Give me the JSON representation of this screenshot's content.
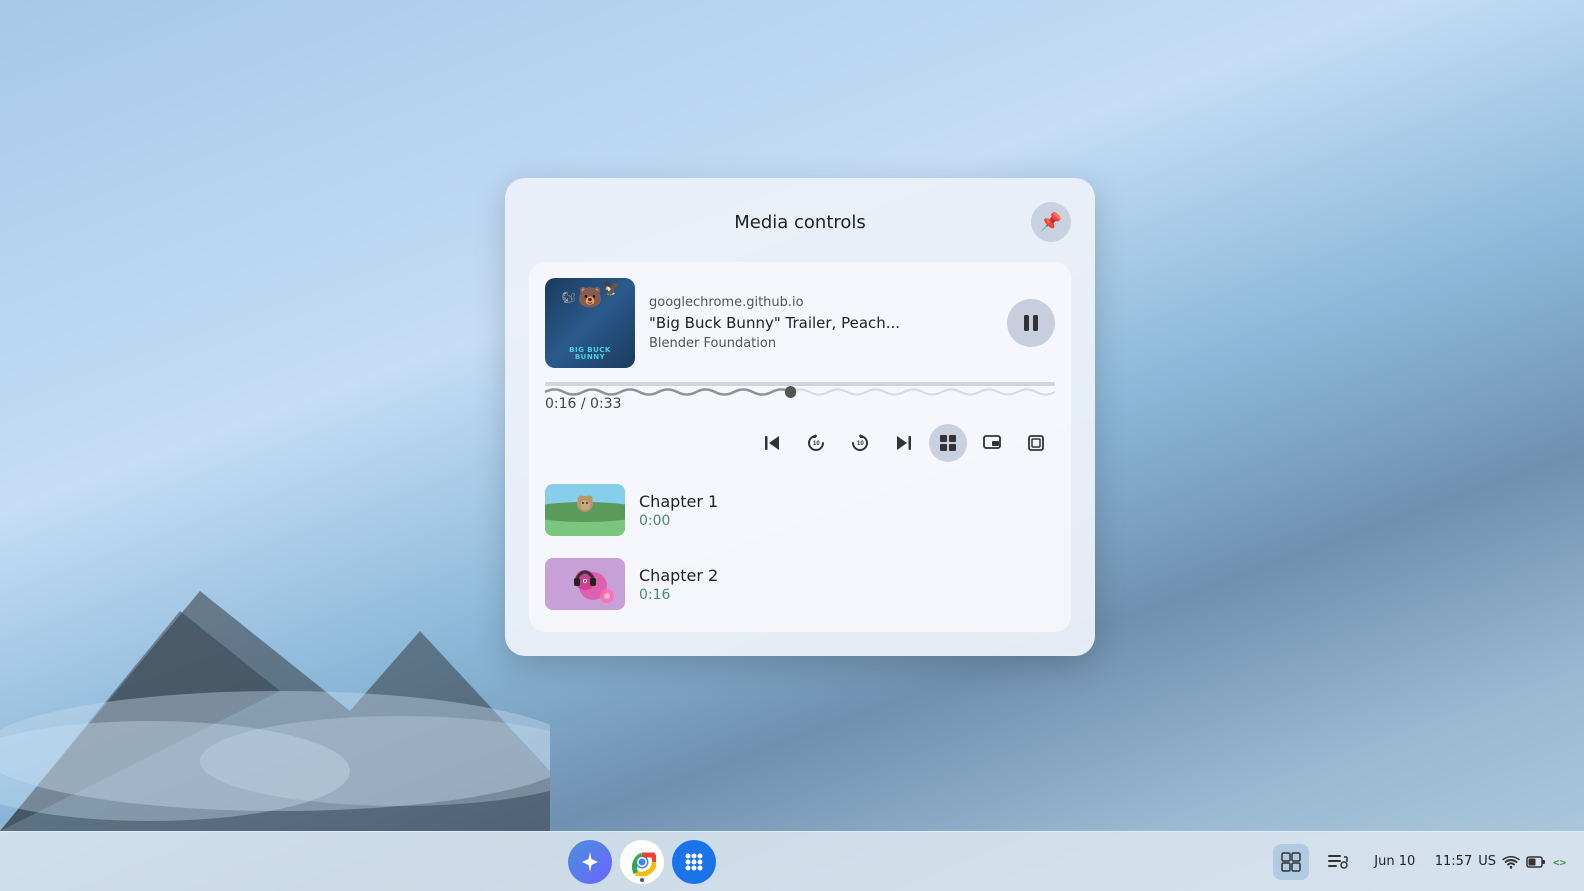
{
  "desktop": {
    "background": "sky-mountain"
  },
  "media_panel": {
    "title": "Media controls",
    "pin_icon": "📌",
    "media_card": {
      "source": "googlechrome.github.io",
      "title": "\"Big Buck Bunny\" Trailer, Peach...",
      "artist": "Blender Foundation",
      "current_time": "0:16",
      "total_time": "0:33",
      "time_display": "0:16 / 0:33",
      "progress_percent": 48,
      "thumbnail_alt": "Big Buck Bunny poster"
    },
    "controls": {
      "skip_back_label": "⏮",
      "replay10_label": "↩10",
      "forward10_label": "↪10",
      "skip_forward_label": "⏭",
      "playlist_label": "▦",
      "picture_in_picture_label": "⧉",
      "fullscreen_label": "⛶",
      "pause_label": "⏸",
      "active_control": "playlist"
    },
    "chapters": [
      {
        "name": "Chapter 1",
        "time": "0:00",
        "thumb_type": "green_field"
      },
      {
        "name": "Chapter 2",
        "time": "0:16",
        "thumb_type": "squirrel"
      }
    ]
  },
  "taskbar": {
    "date": "Jun 10",
    "time": "11:57",
    "region": "US",
    "icons": {
      "launcher_label": "✦",
      "chrome_label": "Chrome",
      "apps_label": "⠿",
      "media_label": "⊞",
      "playlist_label": "≡♪",
      "wifi_label": "WiFi",
      "battery_label": "Battery",
      "dev_label": "<>"
    }
  }
}
